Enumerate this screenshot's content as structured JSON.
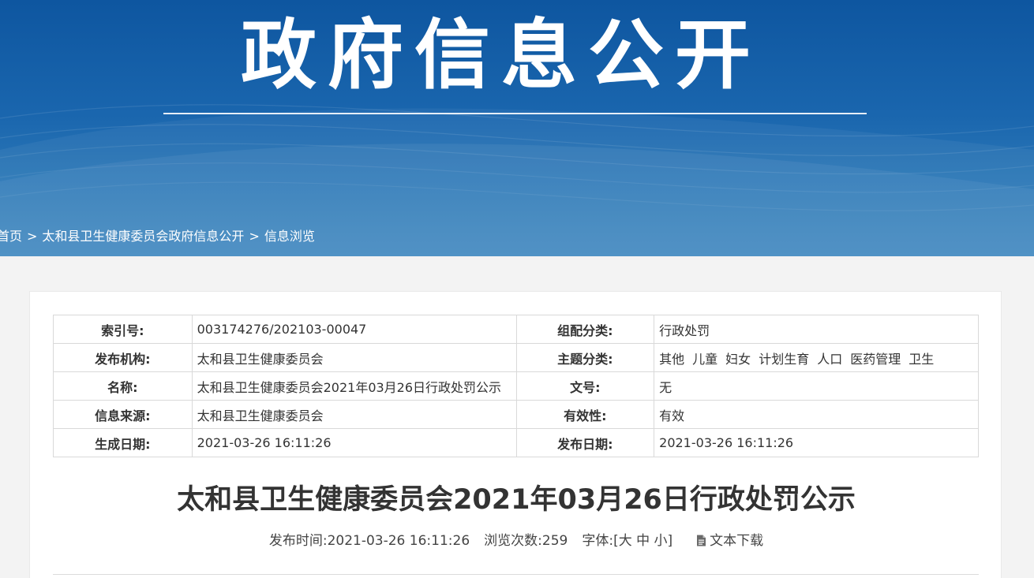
{
  "banner": {
    "title": "政府信息公开"
  },
  "breadcrumb": {
    "items": [
      "首页",
      "太和县卫生健康委员会政府信息公开",
      "信息浏览"
    ],
    "separator": ">"
  },
  "meta": {
    "rows": [
      {
        "k1": "索引号:",
        "v1": "003174276/202103-00047",
        "k2": "组配分类:",
        "v2": "行政处罚"
      },
      {
        "k1": "发布机构:",
        "v1": "太和县卫生健康委员会",
        "k2": "主题分类:",
        "tags": [
          "其他",
          "儿童",
          "妇女",
          "计划生育",
          "人口",
          "医药管理",
          "卫生"
        ]
      },
      {
        "k1": "名称:",
        "v1": "太和县卫生健康委员会2021年03月26日行政处罚公示",
        "k2": "文号:",
        "v2": "无"
      },
      {
        "k1": "信息来源:",
        "v1": "太和县卫生健康委员会",
        "k2": "有效性:",
        "v2": "有效"
      },
      {
        "k1": "生成日期:",
        "v1": "2021-03-26 16:11:26",
        "k2": "发布日期:",
        "v2": "2021-03-26 16:11:26"
      }
    ]
  },
  "article": {
    "title": "太和县卫生健康委员会2021年03月26日行政处罚公示",
    "publish_label": "发布时间:",
    "publish_time": "2021-03-26 16:11:26",
    "views_label": "浏览次数:",
    "views": "259",
    "font_label": "字体:",
    "font_open": "[",
    "font_large": "大",
    "font_medium": "中",
    "font_small": "小",
    "font_close": "]",
    "download_label": "文本下载"
  },
  "colors": {
    "banner_blue": "#1a66ae",
    "text": "#333333"
  }
}
